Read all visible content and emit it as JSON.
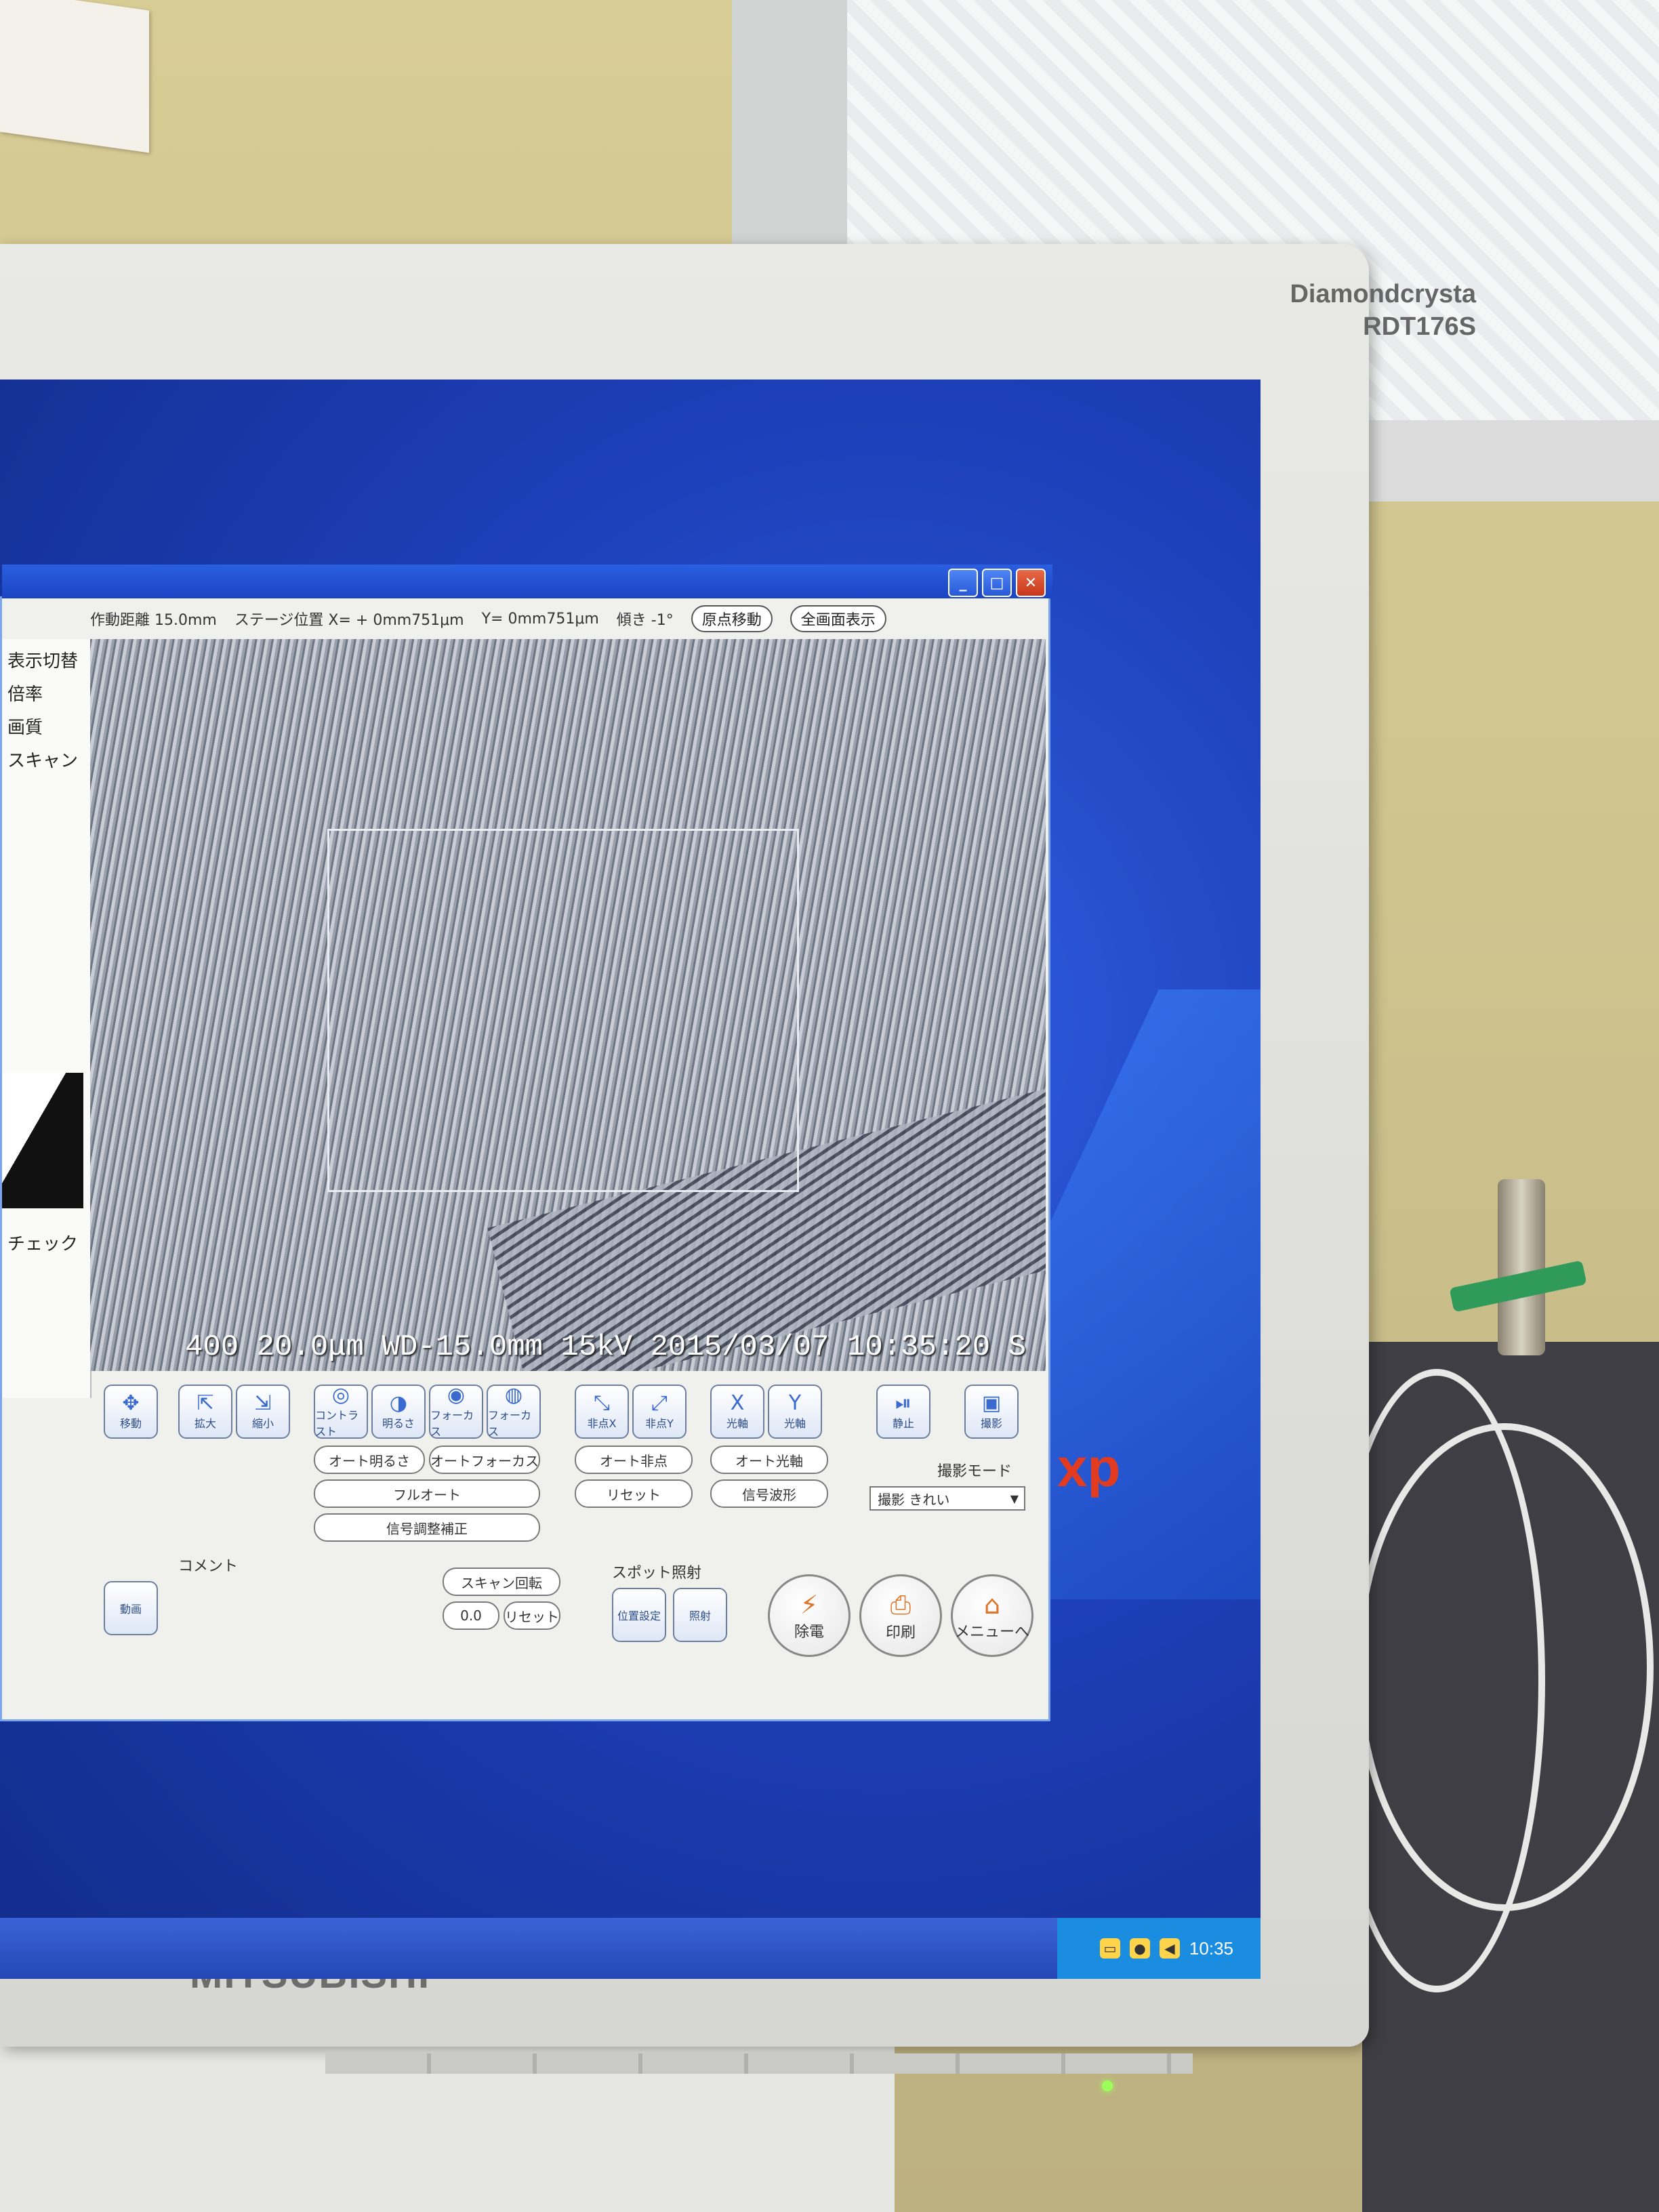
{
  "monitor": {
    "brand_line1": "Diamondcrysta",
    "brand_line2": "RDT176S",
    "maker": "MITSUBISHI"
  },
  "desktop": {
    "os_mark": "xp",
    "clock": "10:35"
  },
  "window_controls": {
    "minimize": "_",
    "maximize": "□",
    "close": "✕"
  },
  "infobar": {
    "wd": "作動距離  15.0mm",
    "stage_x": "ステージ位置  X= +  0mm751μm",
    "stage_y": "Y=  0mm751μm",
    "tilt": "傾き  -1°",
    "origin_button": "原点移動",
    "fullscreen_button": "全画面表示"
  },
  "image": {
    "overlay": "400  20.0μm  WD-15.0mm  15kV  2015/03/07  10:35:20  S"
  },
  "controls": {
    "row1": [
      {
        "glyph": "✥",
        "label": "移動"
      },
      {
        "glyph": "⇱",
        "label": "拡大"
      },
      {
        "glyph": "⇲",
        "label": "縮小"
      },
      {
        "glyph": "◎",
        "label": "コントラスト"
      },
      {
        "glyph": "◑",
        "label": "明るさ"
      },
      {
        "glyph": "◉",
        "label": "フォーカス"
      },
      {
        "glyph": "◍",
        "label": "フォーカス"
      },
      {
        "glyph": "⤡",
        "label": "非点X"
      },
      {
        "glyph": "⤢",
        "label": "非点Y"
      },
      {
        "glyph": "X",
        "label": "光軸"
      },
      {
        "glyph": "Y",
        "label": "光軸"
      },
      {
        "glyph": "⏯",
        "label": "静止"
      },
      {
        "glyph": "▣",
        "label": "撮影"
      }
    ],
    "auto_brightness": "オート明るさ",
    "auto_focus": "オートフォーカス",
    "full_auto": "フルオート",
    "signal_correction": "信号調整補正",
    "auto_astig": "オート非点",
    "auto_axis": "オート光軸",
    "reset": "リセット",
    "signal_wave": "信号波形",
    "mode_label": "撮影モード",
    "mode_value": "撮影  きれい",
    "rotation": "スキャン回転",
    "rotation_value": "0.0",
    "rotation_reset": "リセット",
    "spot_label": "スポット照射",
    "spot_position": "位置設定",
    "spot_fire": "照射",
    "video": "動画",
    "comment": "コメント",
    "discharge": "除電",
    "print": "印刷",
    "menu": "メニューへ"
  },
  "left_panel": {
    "items": [
      "表示切替",
      "倍率",
      "画質",
      "スキャン",
      "チェック"
    ]
  }
}
